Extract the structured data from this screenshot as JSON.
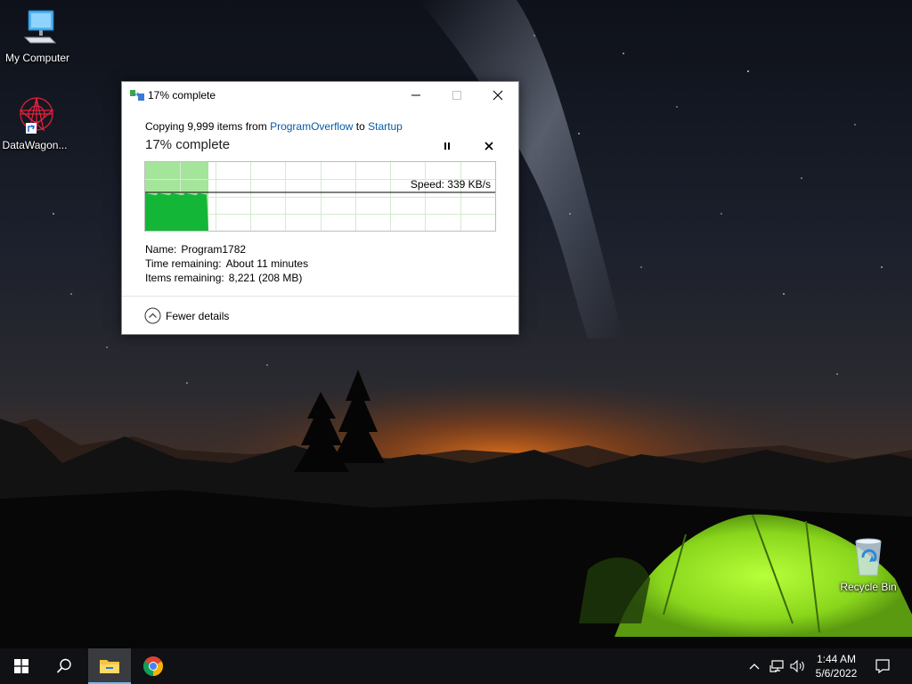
{
  "desktop": {
    "icons": [
      {
        "label": "My Computer",
        "icon": "computer-icon"
      },
      {
        "label": "DataWagon...",
        "icon": "datawagon-app-icon"
      },
      {
        "label": "Recycle Bin",
        "icon": "recycle-bin-icon"
      }
    ]
  },
  "dialog": {
    "title": "17% complete",
    "copy_prefix": "Copying 9,999 items from",
    "source": "ProgramOverflow",
    "connector": "to",
    "destination": "Startup",
    "heading": "17% complete",
    "progress_percent": 17,
    "speed_label": "Speed: 339 KB/s",
    "details": {
      "name_label": "Name:",
      "name_value": "Program1782",
      "time_label": "Time remaining:",
      "time_value": "About 11 minutes",
      "items_label": "Items remaining:",
      "items_value": "8,221 (208 MB)"
    },
    "fewer_details": "Fewer details",
    "colors": {
      "graph_fill": "#13b636",
      "graph_done_bg": "#a5e59b",
      "link": "#0b5aa8"
    }
  },
  "taskbar": {
    "time": "1:44 AM",
    "date": "5/6/2022",
    "apps": [
      "windows-start-icon",
      "search-icon",
      "file-explorer-icon",
      "chrome-icon"
    ],
    "tray": [
      "chevron-up-icon",
      "network-icon",
      "volume-icon",
      "notification-icon"
    ]
  }
}
